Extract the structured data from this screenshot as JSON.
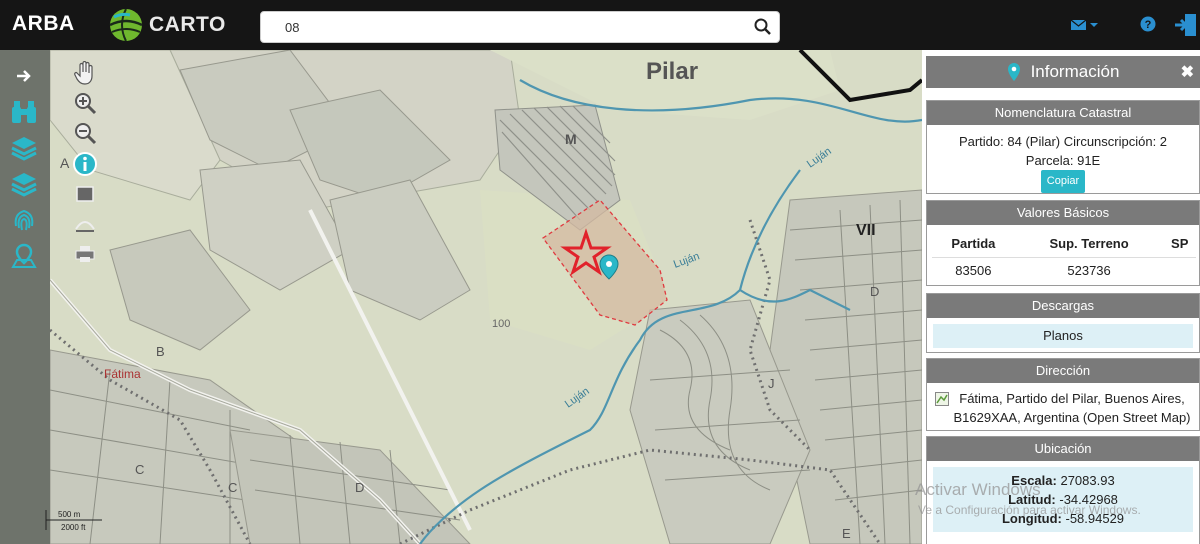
{
  "topbar": {
    "brand": "ARBA",
    "carto_label": "CARTO",
    "search_value": "08"
  },
  "map": {
    "labels": {
      "city": "Pilar",
      "fatima": "Fátima",
      "region_vii": "VII",
      "zone_m": "M",
      "zone_a": "A",
      "zone_b": "B",
      "zone_c_left": "C",
      "zone_c": "C",
      "zone_d_left": "D",
      "zone_d_right": "D",
      "zone_j": "J",
      "zone_e": "E",
      "elevation": "100",
      "river_1": "Luján",
      "river_2": "Luján",
      "river_3": "Luján"
    },
    "scale": {
      "metric": "500 m",
      "imperial": "2000 ft"
    }
  },
  "panel": {
    "title": "Información",
    "nomenclatura": {
      "header": "Nomenclatura Catastral",
      "line1": "Partido: 84 (Pilar) Circunscripción: 2",
      "line2": "Parcela: 91E",
      "copy_label": "Copiar"
    },
    "valores": {
      "header": "Valores Básicos",
      "columns": [
        "Partida",
        "Sup. Terreno",
        "SP"
      ],
      "row": [
        "83506",
        "523736",
        ""
      ]
    },
    "descargas": {
      "header": "Descargas",
      "item": "Planos"
    },
    "direccion": {
      "header": "Dirección",
      "text": "Fátima, Partido del Pilar, Buenos Aires, B1629XAA, Argentina (Open Street Map)"
    },
    "ubicacion": {
      "header": "Ubicación",
      "escala_label": "Escala:",
      "escala_value": "27083.93",
      "latitud_label": "Latitud:",
      "latitud_value": "-34.42968",
      "longitud_label": "Longitud:",
      "longitud_value": "-58.94529"
    }
  },
  "watermark": {
    "line1": "Activar Windows",
    "line2": "Ve a Configuración para activar Windows."
  },
  "colors": {
    "topbar": "#151515",
    "accent": "#2ab7c8",
    "panel_header": "#7a7a7a",
    "parcel_outline": "#e0393f",
    "river": "#4f96b0"
  }
}
